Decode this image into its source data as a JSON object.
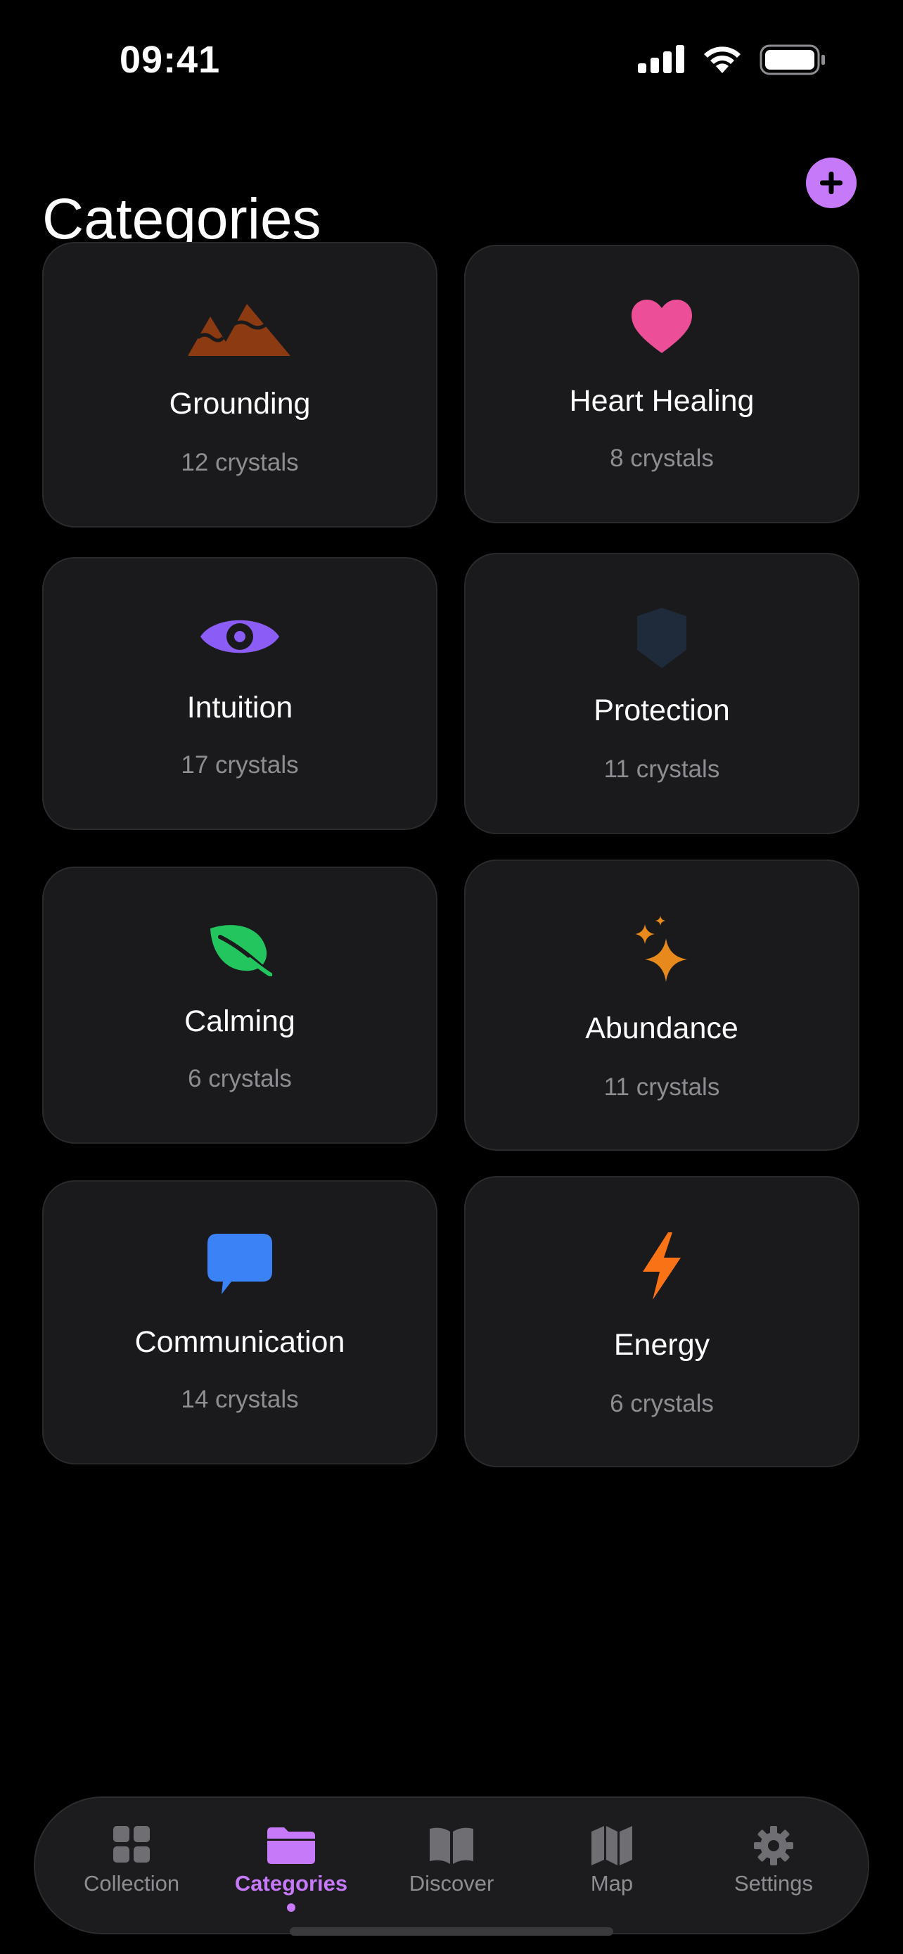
{
  "status_bar": {
    "time": "09:41"
  },
  "header": {
    "title": "Categories",
    "add_icon": "plus-icon",
    "accent": "#c679f8"
  },
  "categories": [
    {
      "name": "Grounding",
      "count": "12 crystals",
      "icon": "mountain-icon",
      "color": "#8b3a12"
    },
    {
      "name": "Heart Healing",
      "count": "8 crystals",
      "icon": "heart-icon",
      "color": "#ec4f97"
    },
    {
      "name": "Intuition",
      "count": "17 crystals",
      "icon": "eye-icon",
      "color": "#8b5cf6"
    },
    {
      "name": "Protection",
      "count": "11 crystals",
      "icon": "shield-icon",
      "color": "#1f2a3a"
    },
    {
      "name": "Calming",
      "count": "6 crystals",
      "icon": "leaf-icon",
      "color": "#22c55e"
    },
    {
      "name": "Abundance",
      "count": "11 crystals",
      "icon": "sparkles-icon",
      "color": "#e7891c"
    },
    {
      "name": "Communication",
      "count": "14 crystals",
      "icon": "chat-bubble-icon",
      "color": "#3b82f6"
    },
    {
      "name": "Energy",
      "count": "6 crystals",
      "icon": "lightning-icon",
      "color": "#f97316"
    }
  ],
  "tab_bar": {
    "active": "Categories",
    "tabs": [
      {
        "label": "Collection",
        "icon": "grid-icon"
      },
      {
        "label": "Categories",
        "icon": "folder-icon"
      },
      {
        "label": "Discover",
        "icon": "book-icon"
      },
      {
        "label": "Map",
        "icon": "map-icon"
      },
      {
        "label": "Settings",
        "icon": "gear-icon"
      }
    ]
  }
}
